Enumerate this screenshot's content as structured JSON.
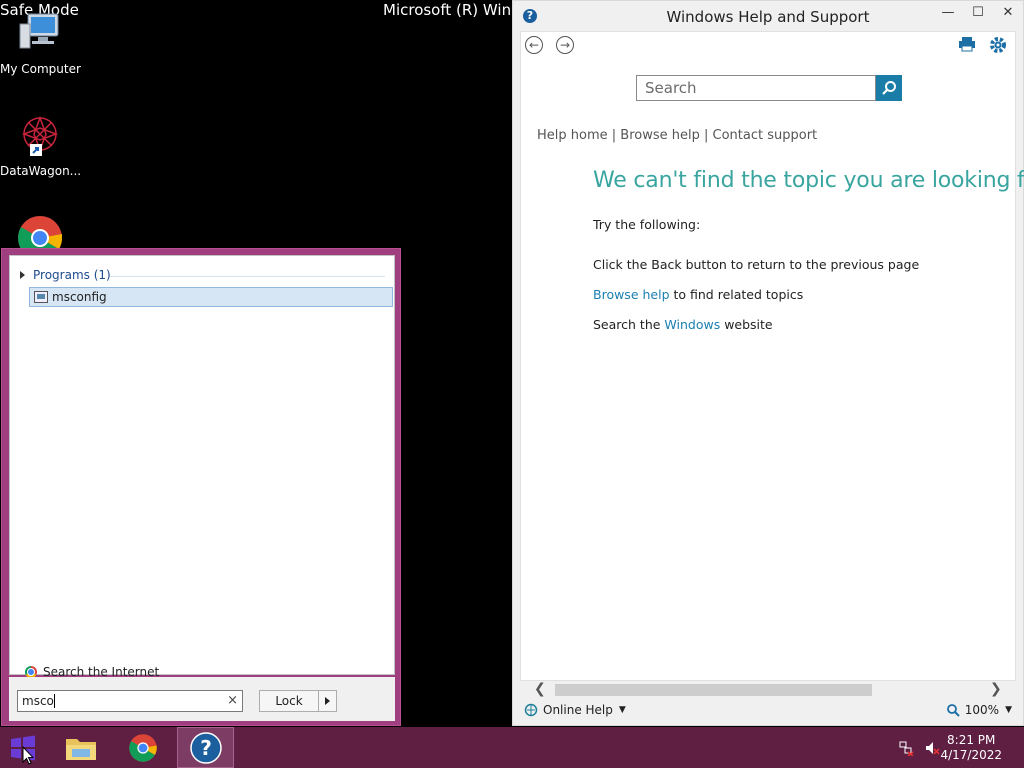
{
  "desktop": {
    "safe_mode_tl": "Safe Mode",
    "title_center": "Microsoft (R) Windo",
    "icons": [
      {
        "label": "My Computer",
        "icon": "computer-icon"
      },
      {
        "label": "DataWagon...",
        "icon": "datawagon-icon"
      },
      {
        "label": "",
        "icon": "chrome-icon"
      }
    ]
  },
  "start_menu": {
    "programs_header": "Programs (1)",
    "result": "msconfig",
    "search_internet": "Search the Internet",
    "search_value": "msco",
    "clear_symbol": "×",
    "lock_label": "Lock"
  },
  "help": {
    "title": "Windows Help and Support",
    "search_placeholder": "Search",
    "links": {
      "home": "Help home",
      "sep": " | ",
      "browse": "Browse help",
      "contact": "Contact support"
    },
    "heading": "We can't find the topic you are looking for",
    "try": "Try the following:",
    "line1": "Click the Back button to return to the previous page",
    "line2_link": "Browse help",
    "line2_rest": " to find related topics",
    "line3_pre": "Search the ",
    "line3_link": "Windows",
    "line3_post": " website",
    "online_help": "Online Help",
    "zoom": "100%"
  },
  "taskbar": {
    "time": "8:21 PM",
    "date": "4/17/2022"
  },
  "colors": {
    "taskbar": "#5e1f43",
    "start_border": "#9f3f7f",
    "help_accent": "#3aa5a0",
    "link": "#1a7fb0"
  }
}
